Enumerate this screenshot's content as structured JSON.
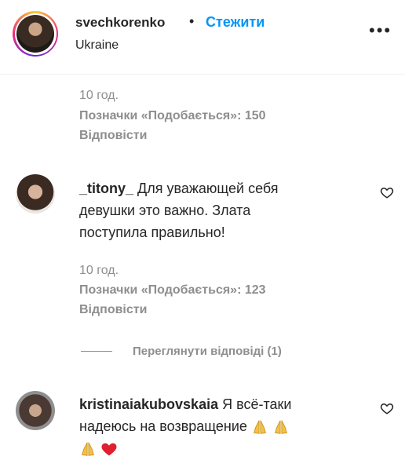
{
  "post": {
    "username": "svechkorenko",
    "separator": "•",
    "follow_label": "Стежити",
    "location": "Ukraine",
    "more_icon": "more-options-icon"
  },
  "comment_prev": {
    "time": "10 год.",
    "likes": "Позначки «Подобається»: 150",
    "reply_label": "Відповісти"
  },
  "comments": [
    {
      "username": "_titony_",
      "text_line1": "Для уважающей себя",
      "text_line2": "девушки это важно. Злата",
      "text_line3": "поступила правильно!",
      "time": "10 год.",
      "likes": "Позначки «Подобається»: 123",
      "reply_label": "Відповісти",
      "view_replies": "Переглянути відповіді (1)"
    },
    {
      "username": "kristinaiakubovskaia",
      "text_line1": "Я всё-таки",
      "text_line2": "надеюсь на возвращение",
      "emojis": [
        "folded-hands-emoji",
        "folded-hands-emoji",
        "folded-hands-emoji",
        "red-heart-emoji"
      ]
    }
  ],
  "colors": {
    "accent": "#0095f6",
    "secondary": "#8e8e8e",
    "text": "#262626"
  }
}
